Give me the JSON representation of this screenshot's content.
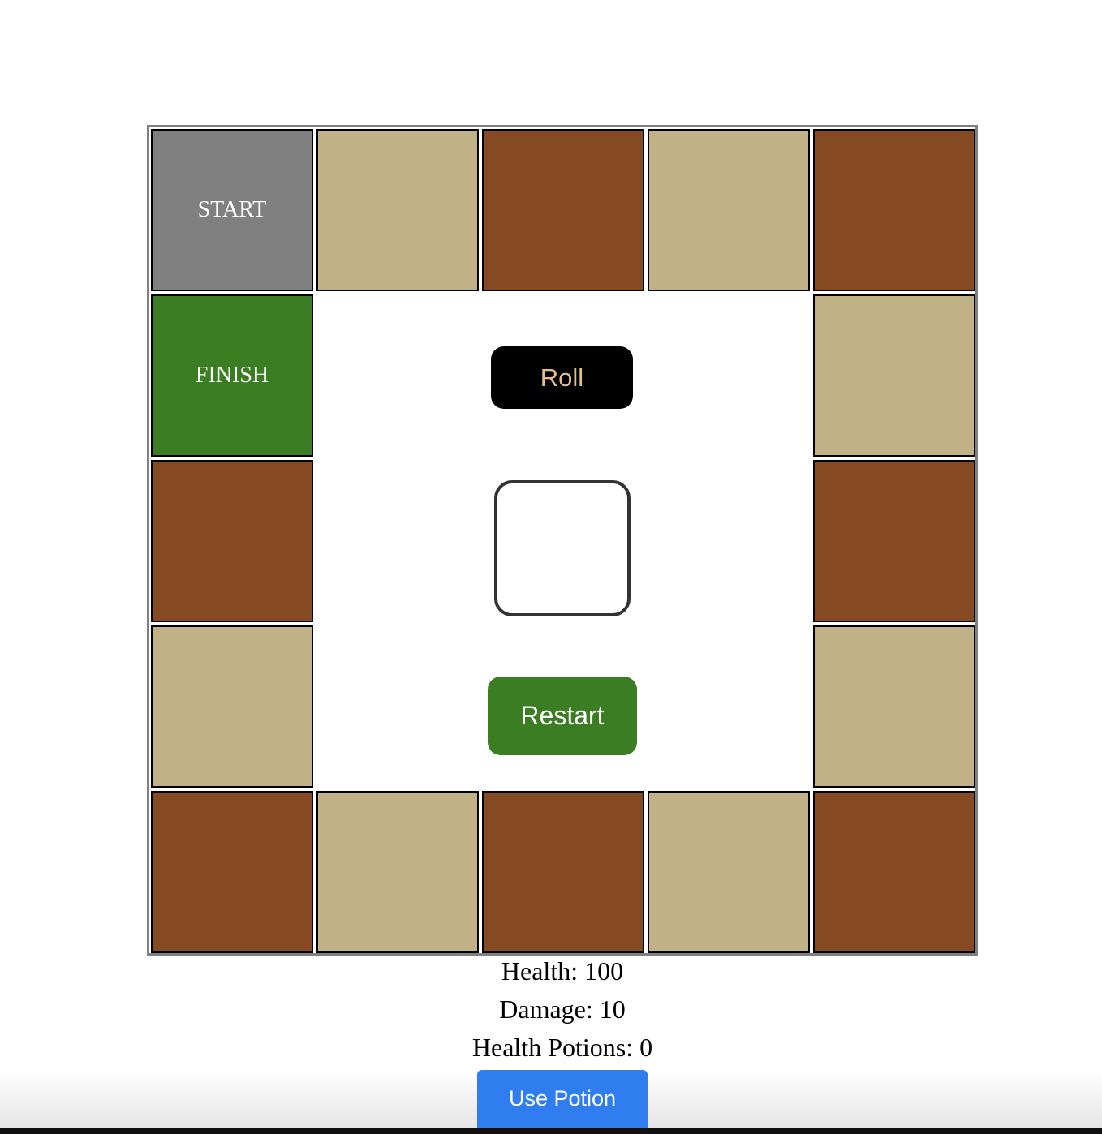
{
  "board": {
    "start_label": "START",
    "finish_label": "FINISH",
    "colors": {
      "light": "#c1b187",
      "dark": "#854a21",
      "start": "#808080",
      "finish": "#3a7d22"
    }
  },
  "controls": {
    "roll_label": "Roll",
    "dice_value": "",
    "restart_label": "Restart",
    "use_potion_label": "Use Potion"
  },
  "stats": {
    "health": "Health: 100",
    "damage": "Damage: 10",
    "potions": "Health Potions: 0"
  }
}
